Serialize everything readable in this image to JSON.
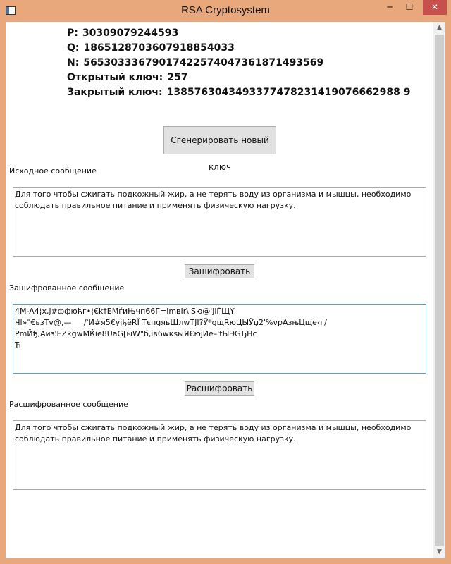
{
  "window": {
    "title": "RSA Cryptosystem",
    "min": "─",
    "max": "☐",
    "close": "✕"
  },
  "keys": {
    "p_label": "P:",
    "p_value": "30309079244593",
    "q_label": "Q:",
    "q_value": "1865128703607918854033",
    "n_label": "N:",
    "n_value": "56530333679017422574047361871493569",
    "public_label": "Открытый ключ:",
    "public_value": "257",
    "private_label": "Закрытый ключ:",
    "private_value": "1385763043493377478231419076662988 9"
  },
  "buttons": {
    "generate": "Сгенерировать новый ключ",
    "encrypt": "Зашифровать",
    "decrypt": "Расшифровать"
  },
  "source": {
    "label": "Исходное сообщение",
    "text": "Для того чтобы сжигать подкожный жир, а не терять воду из организма и мышцы, необходимо соблюдать правильное питание и применять физическую нагрузку."
  },
  "encrypted": {
    "label": "Зашифрованное сообщение",
    "lines": [
      "4M-A4¦x,j#ффюћг•¦€k†EMѓиЊчп66Г=imвIr\\'Sю@'jiЃЩY",
      "Чl»\"€ьзTv@,—     /'И#я5€ујђёRЇ ТєпgяьЩлwTJI?Ў*gщRюЦЫЎџ2'%vpAзњЦще‹г/",
      "PmЙђ,Айз'EZќgwMЌie8UaG[ыW\"б,ів6wкsыЯ€юјИе–'tЫЭGЂHc",
      "Ћ"
    ]
  },
  "decrypted": {
    "label": "Расшифрованное сообщение",
    "text": "Для того чтобы сжигать подкожный жир, а не терять воду из организма и мышцы, необходимо соблюдать правильное питание и применять физическую нагрузку."
  },
  "colors": {
    "frame": "#e8a87c",
    "close": "#c7504d",
    "focus_border": "#569de5"
  }
}
